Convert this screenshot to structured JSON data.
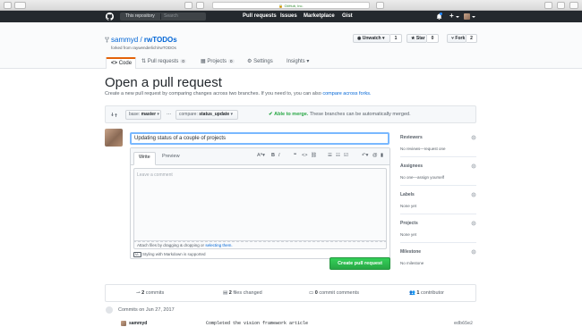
{
  "browser": {
    "url": "GitHub, Inc."
  },
  "header": {
    "scope_label": "This repository",
    "search_placeholder": "Search",
    "nav": [
      "Pull requests",
      "Issues",
      "Marketplace",
      "Gist"
    ],
    "plus_label": "+"
  },
  "repo": {
    "owner": "sammyd",
    "name": "rwTODOs",
    "forked_from": "forked from raywenderlich/rwTODOs",
    "unwatch_label": "Unwatch",
    "unwatch_count": "1",
    "star_label": "Star",
    "star_count": "0",
    "fork_label": "Fork",
    "fork_count": "2",
    "tabs": [
      {
        "label": "Code",
        "count": ""
      },
      {
        "label": "Pull requests",
        "count": "0"
      },
      {
        "label": "Projects",
        "count": "0"
      },
      {
        "label": "Settings",
        "count": ""
      },
      {
        "label": "Insights",
        "count": ""
      }
    ]
  },
  "page": {
    "title": "Open a pull request",
    "subtitle_prefix": "Create a new pull request by comparing changes across two branches. If you need to, you can also",
    "subtitle_link": "compare across forks."
  },
  "range": {
    "base_label": "base:",
    "base_value": "master",
    "ellipsis": "...",
    "compare_label": "compare:",
    "compare_value": "status_update",
    "able": "Able to merge.",
    "able_rest": "These branches can be automatically merged."
  },
  "form": {
    "title_value": "Updating status of a couple of projects",
    "tab_write": "Write",
    "tab_preview": "Preview",
    "comment_placeholder": "Leave a comment",
    "attach_prefix": "Attach files by dragging & dropping or",
    "attach_link": "selecting them.",
    "markdown_hint": "Styling with Markdown is supported",
    "create_label": "Create pull request"
  },
  "sidebar": [
    {
      "heading": "Reviewers",
      "value": "No reviews—request one"
    },
    {
      "heading": "Assignees",
      "value": "No one—assign yourself"
    },
    {
      "heading": "Labels",
      "value": "None yet"
    },
    {
      "heading": "Projects",
      "value": "None yet"
    },
    {
      "heading": "Milestone",
      "value": "No milestone"
    }
  ],
  "summary": {
    "commits": "2",
    "commits_label": "commits",
    "files": "2",
    "files_label": "files changed",
    "comments": "0",
    "comments_label": "commit comments",
    "contributors": "1",
    "contributors_label": "contributor"
  },
  "commits": {
    "date_heading": "Commits on Jun 27, 2017",
    "rows": [
      {
        "author": "sammyd",
        "message": "Completed the vision framework article",
        "sha": "edb65e2"
      }
    ]
  },
  "colors": {
    "accent": "#0366d6",
    "header_bg": "#24292e",
    "success": "#28a745",
    "tab_indicator": "#e36209"
  }
}
